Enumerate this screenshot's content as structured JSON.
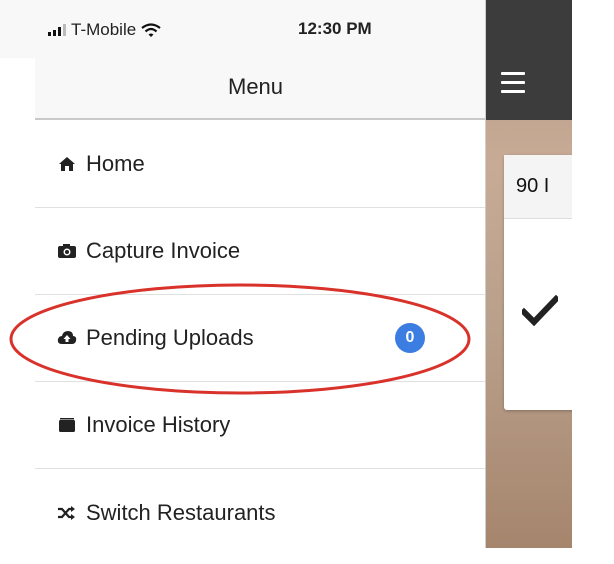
{
  "status_bar": {
    "carrier": "T-Mobile",
    "time": "12:30 PM"
  },
  "header": {
    "title": "Menu"
  },
  "menu": {
    "items": [
      {
        "label": "Home",
        "icon": "home-icon"
      },
      {
        "label": "Capture Invoice",
        "icon": "camera-icon"
      },
      {
        "label": "Pending Uploads",
        "icon": "cloud-upload-icon",
        "badge": "0"
      },
      {
        "label": "Invoice History",
        "icon": "folder-icon"
      },
      {
        "label": "Switch Restaurants",
        "icon": "shuffle-icon"
      }
    ]
  },
  "background_card": {
    "header_text": "90 I"
  },
  "colors": {
    "badge": "#3b7de0",
    "highlight_ellipse": "#d8322b",
    "topbar": "#3c3c3c"
  }
}
